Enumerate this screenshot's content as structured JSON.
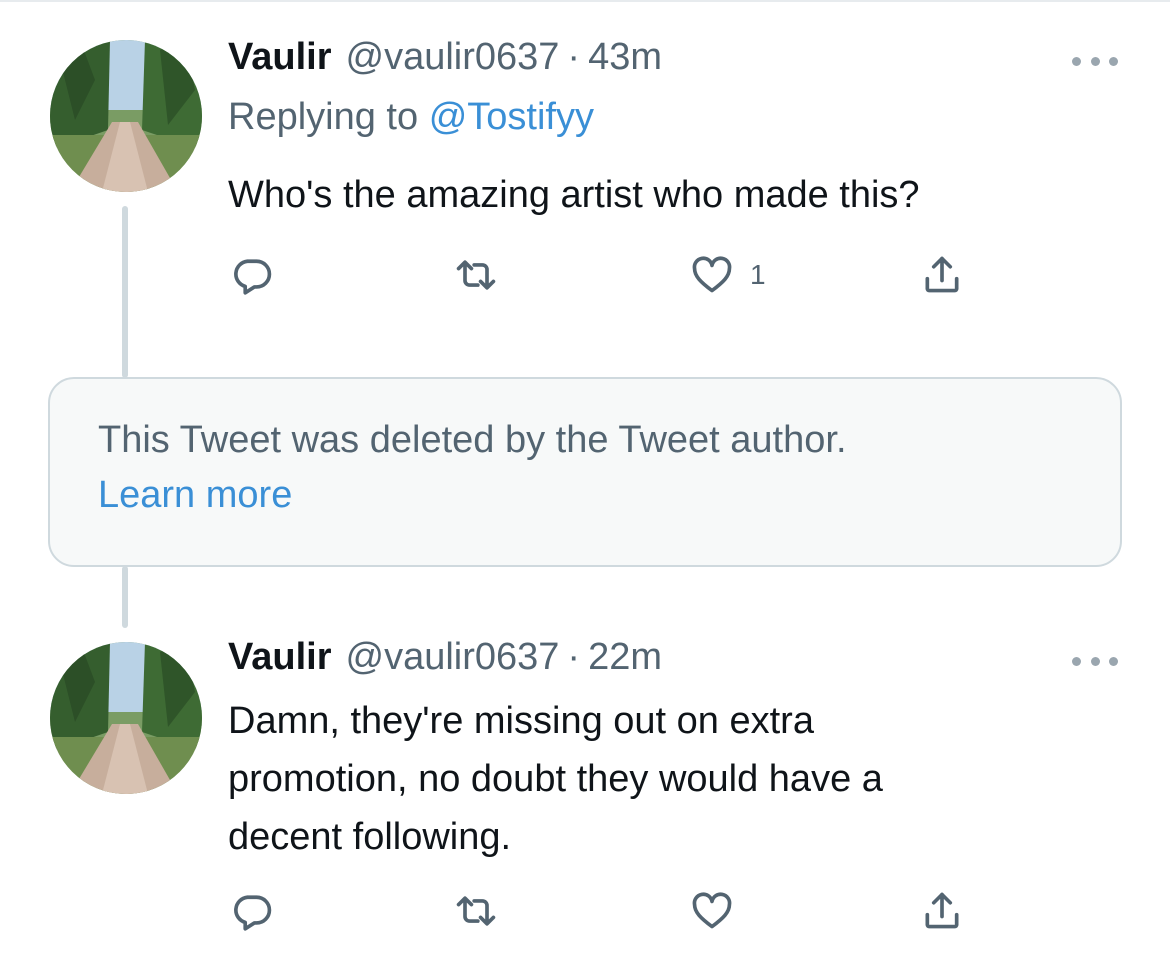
{
  "colors": {
    "text_primary": "#0f1419",
    "text_secondary": "#536471",
    "link": "#3a8fd6",
    "thread_line": "#cfd9de",
    "deleted_box_bg": "#f7f9f9",
    "icon": "#536471"
  },
  "tweets": [
    {
      "display_name": "Vaulir",
      "handle": "@vaulir0637",
      "separator": "·",
      "time": "43m",
      "replying_prefix": "Replying to",
      "replying_to": "@Tostifyy",
      "text": "Who's the amazing artist who made this?",
      "like_count": "1",
      "icons": {
        "avatar": "forest-road-avatar",
        "more": "more-options-icon",
        "reply": "reply-icon",
        "retweet": "retweet-icon",
        "like": "heart-icon",
        "share": "share-icon"
      }
    },
    {
      "display_name": "Vaulir",
      "handle": "@vaulir0637",
      "separator": "·",
      "time": "22m",
      "text_lines": [
        "Damn, they're missing out on extra",
        "promotion, no doubt they would have a",
        "decent following."
      ],
      "icons": {
        "avatar": "forest-road-avatar",
        "more": "more-options-icon",
        "reply": "reply-icon",
        "retweet": "retweet-icon",
        "like": "heart-icon",
        "share": "share-icon"
      }
    }
  ],
  "deleted_notice": {
    "text": "This Tweet was deleted by the Tweet author.",
    "link": "Learn more"
  }
}
